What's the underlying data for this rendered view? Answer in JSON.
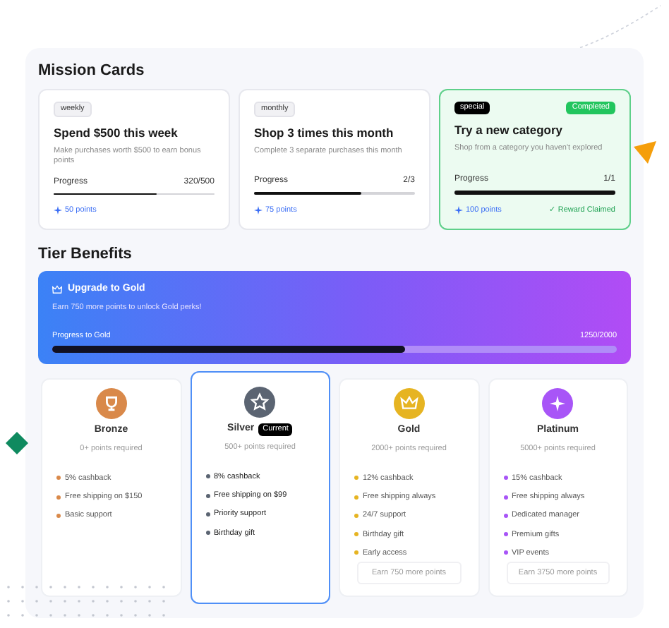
{
  "missions_title": "Mission Cards",
  "missions": [
    {
      "tag": "weekly",
      "kind": "regular",
      "title": "Spend $500 this week",
      "description": "Make purchases worth $500 to earn bonus points",
      "progress_label": "Progress",
      "progress_value": "320/500",
      "level": 0.64,
      "points": "50 points",
      "completed": false
    },
    {
      "tag": "monthly",
      "kind": "regular",
      "title": "Shop 3 times this month",
      "description": "Complete 3 separate purchases this month",
      "progress_label": "Progress",
      "progress_value": "2/3",
      "level": 0.667,
      "points": "75 points",
      "completed": false
    },
    {
      "tag": "special",
      "kind": "special",
      "title": "Try a new category",
      "description": "Shop from a category you haven't explored",
      "progress_label": "Progress",
      "progress_value": "1/1",
      "level": 1,
      "points": "100 points",
      "completed": true,
      "status_badge": "Completed",
      "reward_note": "✓ Reward Claimed"
    }
  ],
  "tier_title": "Tier Benefits",
  "upgrade": {
    "title": "Upgrade to Gold",
    "subtitle": "Earn 750 more points to unlock Gold perks!",
    "progress_label": "Progress to Gold",
    "progress_value": "1250/2000",
    "level": 0.625
  },
  "tiers": [
    {
      "name": "Bronze",
      "color": "#d9894a",
      "requirement": "0+ points required",
      "selected": false,
      "benefits": [
        "5% cashback",
        "Free shipping on $150",
        "Basic support"
      ]
    },
    {
      "name": "Silver",
      "color": "#5b6472",
      "requirement": "500+ points required",
      "selected": true,
      "badge": "Current",
      "benefits": [
        "8% cashback",
        "Free shipping on $99",
        "Priority support",
        "Birthday gift"
      ]
    },
    {
      "name": "Gold",
      "color": "#e6b422",
      "requirement": "2000+ points required",
      "selected": false,
      "benefits": [
        "12% cashback",
        "Free shipping always",
        "24/7 support",
        "Birthday gift",
        "Early access"
      ],
      "action": "Earn 750 more points"
    },
    {
      "name": "Platinum",
      "color": "#a855f7",
      "requirement": "5000+ points required",
      "selected": false,
      "benefits": [
        "15% cashback",
        "Free shipping always",
        "Dedicated manager",
        "Premium gifts",
        "VIP events"
      ],
      "action": "Earn 3750 more points"
    }
  ]
}
